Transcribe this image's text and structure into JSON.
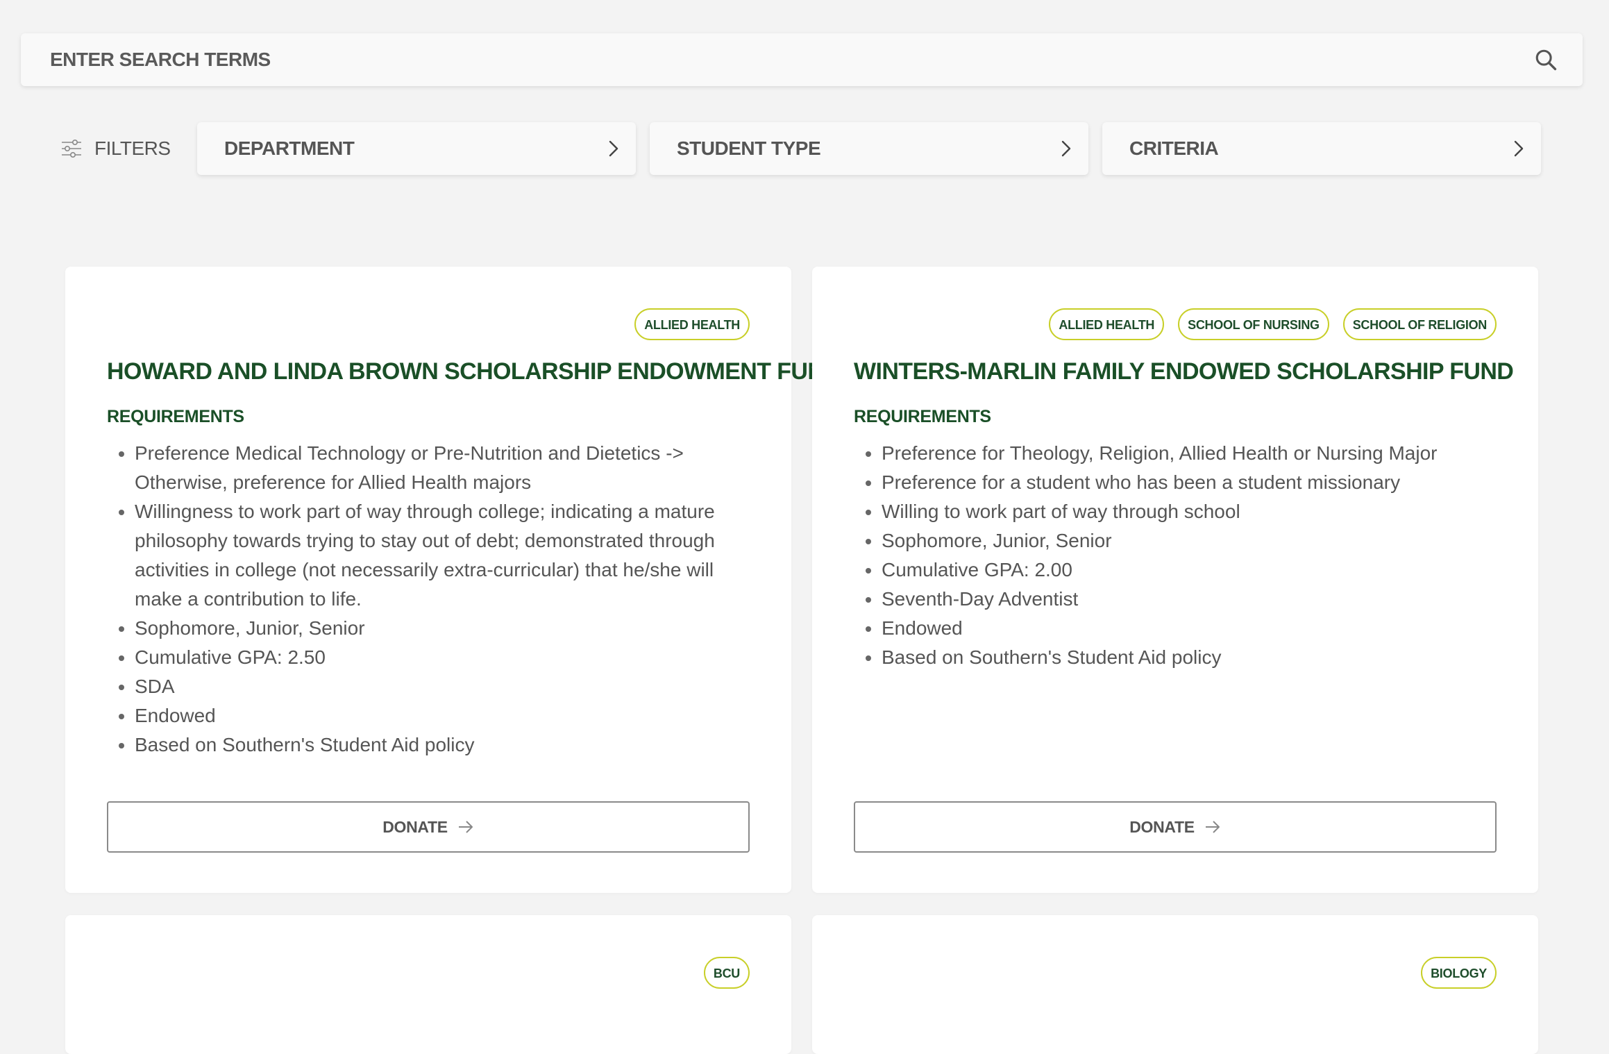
{
  "search": {
    "placeholder": "ENTER SEARCH TERMS"
  },
  "filters": {
    "label": "FILTERS",
    "department": "DEPARTMENT",
    "student_type": "STUDENT TYPE",
    "criteria": "CRITERIA"
  },
  "cards": [
    {
      "tags": [
        "ALLIED HEALTH"
      ],
      "title": "HOWARD AND LINDA BROWN SCHOLARSHIP ENDOWMENT FUND",
      "requirements_heading": "REQUIREMENTS",
      "requirements": [
        "Preference Medical Technology or Pre-Nutrition and Dietetics -> Otherwise, preference for Allied Health majors",
        "Willingness to work part of way through college; indicating a mature philosophy towards trying to stay out of debt; demonstrated through activities in college (not necessarily extra-curricular) that he/she will make a contribution to life.",
        "Sophomore, Junior, Senior",
        "Cumulative GPA: 2.50",
        "SDA",
        "Endowed",
        "Based on Southern's Student Aid policy"
      ],
      "donate_label": "DONATE"
    },
    {
      "tags": [
        "ALLIED HEALTH",
        "SCHOOL OF NURSING",
        "SCHOOL OF RELIGION"
      ],
      "title": "WINTERS-MARLIN FAMILY ENDOWED SCHOLARSHIP FUND",
      "requirements_heading": "REQUIREMENTS",
      "requirements": [
        "Preference for Theology, Religion, Allied Health or Nursing Major",
        "Preference for a student who has been a student missionary",
        "Willing to work part of way through school",
        "Sophomore, Junior, Senior",
        "Cumulative GPA: 2.00",
        "Seventh-Day Adventist",
        "Endowed",
        "Based on Southern's Student Aid policy"
      ],
      "donate_label": "DONATE"
    },
    {
      "tags": [
        "BCU"
      ]
    },
    {
      "tags": [
        "BIOLOGY"
      ]
    }
  ],
  "colors": {
    "background": "#f3f3f3",
    "accent_green": "#1a4f27",
    "tag_border": "#c8cf28"
  },
  "icons": {
    "search": "search-icon",
    "filters": "sliders-icon",
    "chevron": "chevron-right-icon",
    "donate_arrow": "arrow-right-icon"
  }
}
